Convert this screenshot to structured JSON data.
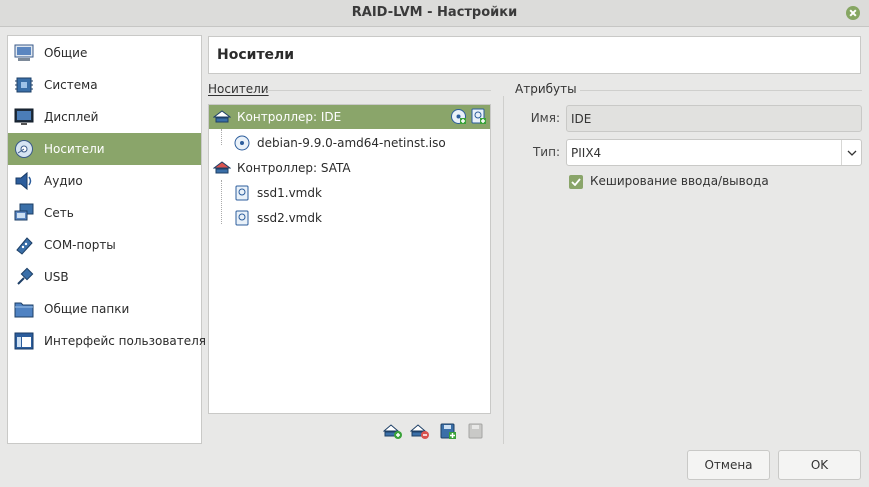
{
  "window": {
    "title": "RAID-LVM - Настройки"
  },
  "sidebar": {
    "items": [
      {
        "label": "Общие",
        "icon": "general-icon",
        "active": false
      },
      {
        "label": "Система",
        "icon": "system-icon",
        "active": false
      },
      {
        "label": "Дисплей",
        "icon": "display-icon",
        "active": false
      },
      {
        "label": "Носители",
        "icon": "storage-icon",
        "active": true
      },
      {
        "label": "Аудио",
        "icon": "audio-icon",
        "active": false
      },
      {
        "label": "Сеть",
        "icon": "network-icon",
        "active": false
      },
      {
        "label": "COM-порты",
        "icon": "serial-ports-icon",
        "active": false
      },
      {
        "label": "USB",
        "icon": "usb-icon",
        "active": false
      },
      {
        "label": "Общие папки",
        "icon": "shared-folders-icon",
        "active": false
      },
      {
        "label": "Интерфейс пользователя",
        "icon": "user-interface-icon",
        "active": false
      }
    ]
  },
  "header": {
    "title": "Носители"
  },
  "storage": {
    "group_label": "Носители",
    "tree": [
      {
        "label": "Контроллер: IDE",
        "type": "controller",
        "selected": true
      },
      {
        "label": "debian-9.9.0-amd64-netinst.iso",
        "type": "optical",
        "selected": false
      },
      {
        "label": "Контроллер: SATA",
        "type": "controller",
        "selected": false
      },
      {
        "label": "ssd1.vmdk",
        "type": "disk",
        "selected": false
      },
      {
        "label": "ssd2.vmdk",
        "type": "disk",
        "selected": false
      }
    ]
  },
  "attributes": {
    "group_label": "Атрибуты",
    "name_label": "Имя:",
    "name_value": "IDE",
    "type_label": "Тип:",
    "type_value": "PIIX4",
    "io_cache_label": "Кеширование ввода/вывода",
    "io_cache_checked": true
  },
  "buttons": {
    "cancel": "Отмена",
    "ok": "OK"
  },
  "colors": {
    "accent": "#8aa56a",
    "accent_dark": "#6d8a4f"
  }
}
